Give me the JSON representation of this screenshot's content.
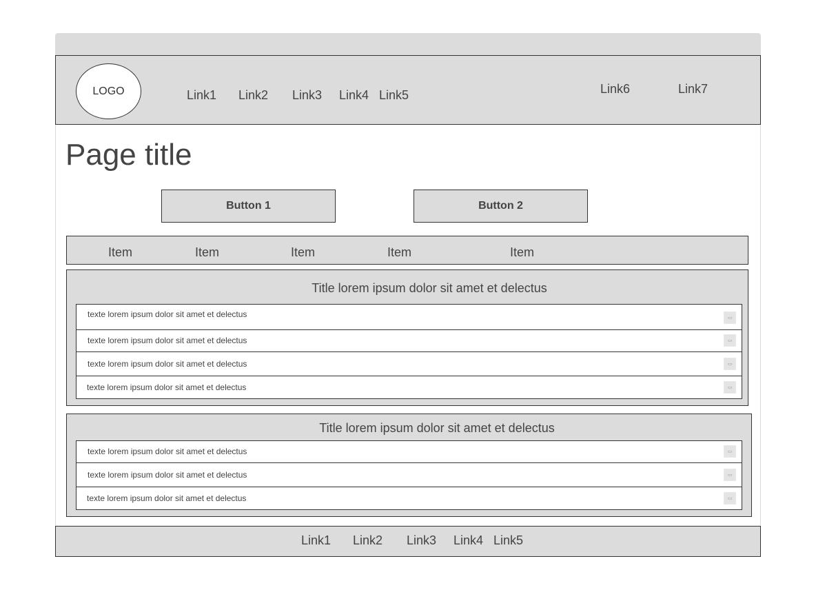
{
  "header": {
    "logo": "LOGO",
    "nav": [
      "Link1",
      "Link2",
      "Link3",
      "Link4",
      "Link5"
    ],
    "nav_right": [
      "Link6",
      "Link7"
    ]
  },
  "page_title": "Page title",
  "buttons": [
    "Button 1",
    "Button 2"
  ],
  "items": [
    "Item",
    "Item",
    "Item",
    "Item",
    "Item"
  ],
  "panels": [
    {
      "title": "Title lorem ipsum dolor sit amet et delectus",
      "rows": [
        "texte lorem ipsum dolor sit amet et delectus",
        "texte lorem ipsum dolor sit amet et delectus",
        "texte lorem ipsum dolor sit amet et delectus",
        "texte lorem ipsum dolor sit amet et delectus"
      ]
    },
    {
      "title": "Title lorem ipsum dolor sit amet et delectus",
      "rows": [
        "texte lorem ipsum dolor sit amet et delectus",
        "texte lorem ipsum dolor sit amet et delectus",
        "texte lorem ipsum dolor sit amet et delectus"
      ]
    }
  ],
  "footer": {
    "nav": [
      "Link1",
      "Link2",
      "Link3",
      "Link4",
      "Link5"
    ]
  },
  "icons": {
    "row_action": "window-icon"
  },
  "colors": {
    "panel_bg": "#dcdcdc",
    "border": "#333333",
    "text": "#444444"
  }
}
